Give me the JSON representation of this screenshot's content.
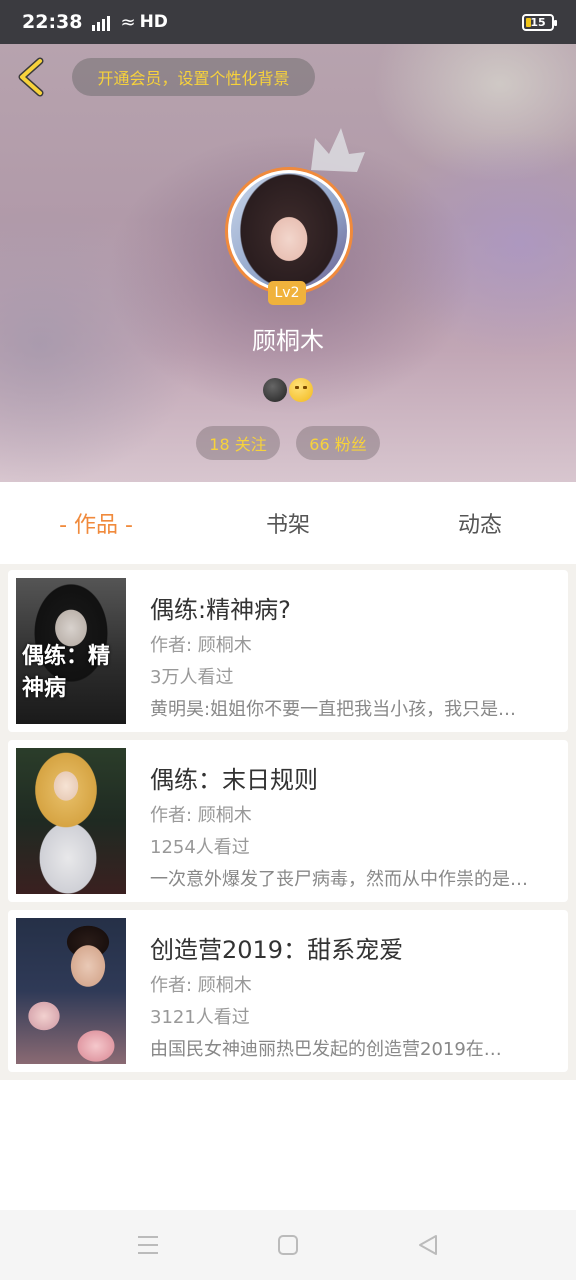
{
  "status_bar": {
    "time": "22:38",
    "network": "4G",
    "hd": "HD",
    "battery": "15"
  },
  "header": {
    "vip_text": "开通会员，设置个性化背景",
    "level": "Lv2",
    "username": "顾桐木",
    "following": "18 关注",
    "fans": "66 粉丝"
  },
  "tabs": [
    {
      "label": "- 作品 -",
      "active": true
    },
    {
      "label": "书架",
      "active": false
    },
    {
      "label": "动态",
      "active": false
    }
  ],
  "works": [
    {
      "title": "偶练:精神病?",
      "author": "作者: 顾桐木",
      "views": "3万人看过",
      "desc": "黄明昊:姐姐你不要一直把我当小孩，我只是…",
      "cover_text": "偶练：精神病"
    },
    {
      "title": "偶练：末日规则",
      "author": "作者: 顾桐木",
      "views": "1254人看过",
      "desc": "一次意外爆发了丧尸病毒，然而从中作祟的是…",
      "cover_text": ""
    },
    {
      "title": "创造营2019：甜系宠爱",
      "author": "作者: 顾桐木",
      "views": "3121人看过",
      "desc": "由国民女神迪丽热巴发起的创造营2019在…",
      "cover_text": ""
    }
  ],
  "colors": {
    "accent": "#f08a3c",
    "gold": "#f7d23b"
  }
}
